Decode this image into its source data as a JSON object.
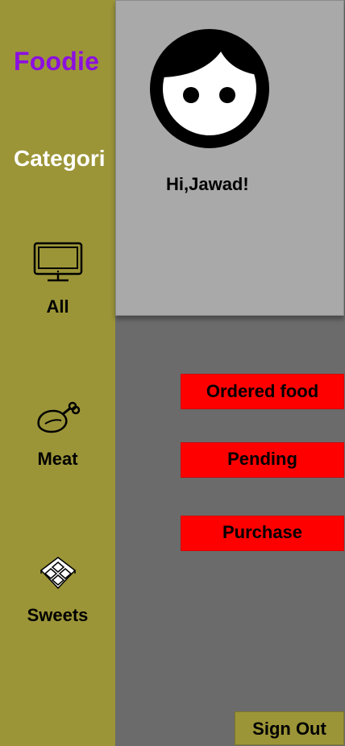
{
  "brand": {
    "name": "Foodie",
    "color": "#8b0fe0"
  },
  "sidebar": {
    "title": "Categori",
    "background": "#9c9538",
    "categories": [
      {
        "label": "All",
        "icon": "monitor-icon"
      },
      {
        "label": "Meat",
        "icon": "chicken-leg-icon"
      },
      {
        "label": "Sweets",
        "icon": "candy-box-icon"
      }
    ]
  },
  "profile": {
    "greeting": "Hi,Jawad!",
    "avatar_icon": "face-avatar-icon"
  },
  "actions": [
    {
      "label": "Ordered food",
      "color": "#ff0000"
    },
    {
      "label": "Pending",
      "color": "#ff0000"
    },
    {
      "label": "Purchase",
      "color": "#ff0000"
    }
  ],
  "footer": {
    "signout_label": "Sign Out"
  }
}
